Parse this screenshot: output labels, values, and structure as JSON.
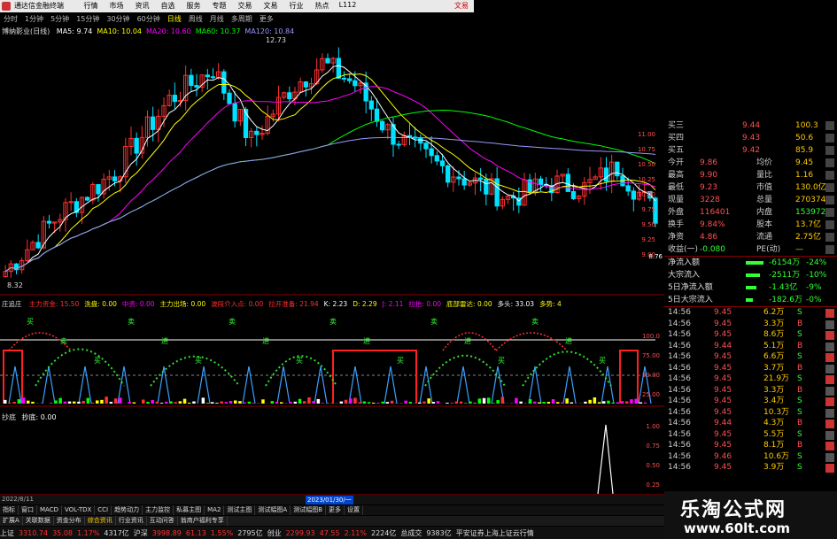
{
  "window": {
    "app_title": "通达信金融终端",
    "menus": [
      "行情",
      "市场",
      "资讯",
      "自选",
      "服务",
      "专题",
      "交易",
      "文易",
      "行业",
      "热点",
      "L112"
    ],
    "account": "文易"
  },
  "period_tabs": {
    "items": [
      "分时",
      "1分钟",
      "5分钟",
      "15分钟",
      "30分钟",
      "60分钟",
      "日线",
      "周线",
      "月线",
      "多周期",
      "更多"
    ],
    "active_index": 6
  },
  "main_chart": {
    "stock_label": "博纳影业(日线)",
    "ma_legend": [
      {
        "label": "MA5: 9.74",
        "color": "#ffffff"
      },
      {
        "label": "MA10: 10.04",
        "color": "#ffff00"
      },
      {
        "label": "MA20: 10.60",
        "color": "#ff00ff"
      },
      {
        "label": "MA60: 10.37",
        "color": "#00ff00"
      },
      {
        "label": "MA120: 10.84",
        "color": "#9999ff"
      }
    ],
    "high_label": "12.73",
    "low_label": "8.32",
    "price_axis": [
      "11.00",
      "10.75",
      "10.50",
      "10.25",
      "10.00",
      "9.75",
      "9.50",
      "9.25",
      "9.00"
    ],
    "current_price_tag": "8.76"
  },
  "indicator_chart": {
    "name": "庄追庄",
    "legend": [
      {
        "label": "主力资金: 15.50",
        "color": "#ff3030"
      },
      {
        "label": "洗盘: 0.00",
        "color": "#ffff00"
      },
      {
        "label": "中资: 0.00",
        "color": "#ff00ff"
      },
      {
        "label": "主力出场: 0.00",
        "color": "#ffff00"
      },
      {
        "label": "波段介入点: 0.00",
        "color": "#ff3030"
      },
      {
        "label": "拉开准备: 21.94",
        "color": "#ff3030"
      },
      {
        "label": "K: 2.23",
        "color": "#ffffff"
      },
      {
        "label": "D: 2.29",
        "color": "#ffff00"
      },
      {
        "label": "J: 2.11",
        "color": "#ff00ff"
      },
      {
        "label": "拉抬: 0.00",
        "color": "#ff00ff"
      },
      {
        "label": "底部雷达: 0.00",
        "color": "#ffff00"
      },
      {
        "label": "多头: 33.03",
        "color": "#ffffff"
      },
      {
        "label": "多势: 4",
        "color": "#ffff00"
      }
    ],
    "axis": [
      "100.0",
      "75.00",
      "50.00",
      "25.00"
    ],
    "signals": [
      "买",
      "卖",
      "买",
      "卖",
      "进",
      "买",
      "卖",
      "进",
      "买",
      "卖",
      "进",
      "买",
      "卖",
      "进",
      "买",
      "卖",
      "进",
      "买"
    ]
  },
  "third_chart": {
    "name": "抄底",
    "value_label": "抄底: 0.00",
    "axis": [
      "1.00",
      "0.75",
      "0.50",
      "0.25"
    ]
  },
  "date_bar": {
    "left": "2022/8/11",
    "marker": "2023/01/30/一"
  },
  "quote_panel": {
    "bids": [
      {
        "label": "买三",
        "price": "9.44",
        "vol": "100.3"
      },
      {
        "label": "买四",
        "price": "9.43",
        "vol": "50.6"
      },
      {
        "label": "买五",
        "price": "9.42",
        "vol": "85.9"
      }
    ],
    "stats": [
      {
        "l1": "今开",
        "v1": "9.86",
        "l2": "均价",
        "v2": "9.45"
      },
      {
        "l1": "最高",
        "v1": "9.90",
        "l2": "量比",
        "v2": "1.16"
      },
      {
        "l1": "最低",
        "v1": "9.23",
        "l2": "市值",
        "v2": "130.0亿"
      },
      {
        "l1": "现量",
        "v1": "3228",
        "l2": "总量",
        "v2": "270374"
      },
      {
        "l1": "外盘",
        "v1": "116401",
        "l2": "内盘",
        "v2": "153972"
      },
      {
        "l1": "换手",
        "v1": "9.84%",
        "l2": "股本",
        "v2": "13.7亿"
      },
      {
        "l1": "净资",
        "v1": "4.86",
        "l2": "流通",
        "v2": "2.75亿"
      },
      {
        "l1": "收益(一)",
        "v1": "-0.080",
        "l2": "PE(动)",
        "v2": "—"
      }
    ],
    "flows": [
      {
        "label": "净流入额",
        "val": "-6154万",
        "pct": "-24%"
      },
      {
        "label": "大宗流入",
        "val": "-2511万",
        "pct": "-10%"
      },
      {
        "label": "5日净流入额",
        "val": "-1.43亿",
        "pct": "-9%"
      },
      {
        "label": "5日大宗流入",
        "val": "-182.6万",
        "pct": "-0%"
      }
    ],
    "ticks": [
      {
        "time": "14:56",
        "price": "9.45",
        "vol": "6.2万",
        "bs": "S"
      },
      {
        "time": "14:56",
        "price": "9.45",
        "vol": "3.3万",
        "bs": "B"
      },
      {
        "time": "14:56",
        "price": "9.45",
        "vol": "8.6万",
        "bs": "S"
      },
      {
        "time": "14:56",
        "price": "9.44",
        "vol": "5.1万",
        "bs": "B"
      },
      {
        "time": "14:56",
        "price": "9.45",
        "vol": "6.6万",
        "bs": "S"
      },
      {
        "time": "14:56",
        "price": "9.45",
        "vol": "3.7万",
        "bs": "B"
      },
      {
        "time": "14:56",
        "price": "9.45",
        "vol": "21.9万",
        "bs": "S"
      },
      {
        "time": "14:56",
        "price": "9.45",
        "vol": "3.3万",
        "bs": "B"
      },
      {
        "time": "14:56",
        "price": "9.45",
        "vol": "3.4万",
        "bs": "S"
      },
      {
        "time": "14:56",
        "price": "9.45",
        "vol": "10.3万",
        "bs": "S"
      },
      {
        "time": "14:56",
        "price": "9.44",
        "vol": "4.3万",
        "bs": "B"
      },
      {
        "time": "14:56",
        "price": "9.45",
        "vol": "5.5万",
        "bs": "S"
      },
      {
        "time": "14:56",
        "price": "9.45",
        "vol": "8.1万",
        "bs": "B"
      },
      {
        "time": "14:56",
        "price": "9.46",
        "vol": "10.6万",
        "bs": "S"
      },
      {
        "time": "14:56",
        "price": "9.45",
        "vol": "3.9万",
        "bs": "S"
      }
    ]
  },
  "bottom_tabs": [
    "指标",
    "窗口",
    "MACD",
    "VOL-TDX",
    "CCI",
    "趋势动力",
    "主力监控",
    "私募主图",
    "MA2",
    "测试主图",
    "测试幅图A",
    "测试幅图B",
    "更多",
    "设置"
  ],
  "bottom_bar2": [
    "扩展A",
    "关联数据",
    "资金分布",
    "综合资讯",
    "行业资讯",
    "互动问答",
    "翁商户福利专享"
  ],
  "statusbar": [
    {
      "text": "上证",
      "color": "#ddd"
    },
    {
      "text": "3310.74",
      "color": "#ff3030"
    },
    {
      "text": "35.08",
      "color": "#ff3030"
    },
    {
      "text": "1.17%",
      "color": "#ff3030"
    },
    {
      "text": "4317亿",
      "color": "#ddd"
    },
    {
      "text": "沪深",
      "color": "#ddd"
    },
    {
      "text": "3998.89",
      "color": "#ff3030"
    },
    {
      "text": "61.13",
      "color": "#ff3030"
    },
    {
      "text": "1.55%",
      "color": "#ff3030"
    },
    {
      "text": "2795亿",
      "color": "#ddd"
    },
    {
      "text": "创业",
      "color": "#ddd"
    },
    {
      "text": "2299.93",
      "color": "#ff3030"
    },
    {
      "text": "47.55",
      "color": "#ff3030"
    },
    {
      "text": "2.11%",
      "color": "#ff3030"
    },
    {
      "text": "2224亿",
      "color": "#ddd"
    },
    {
      "text": "总成交",
      "color": "#ddd"
    },
    {
      "text": "9383亿",
      "color": "#ddd"
    },
    {
      "text": "平安证券上海上证云行情",
      "color": "#ddd"
    }
  ],
  "watermark": {
    "title": "乐淘公式网",
    "url": "www.60lt.com"
  },
  "colors": {
    "up": "#ff3030",
    "down": "#00e0ff",
    "grid": "#8b0000"
  }
}
